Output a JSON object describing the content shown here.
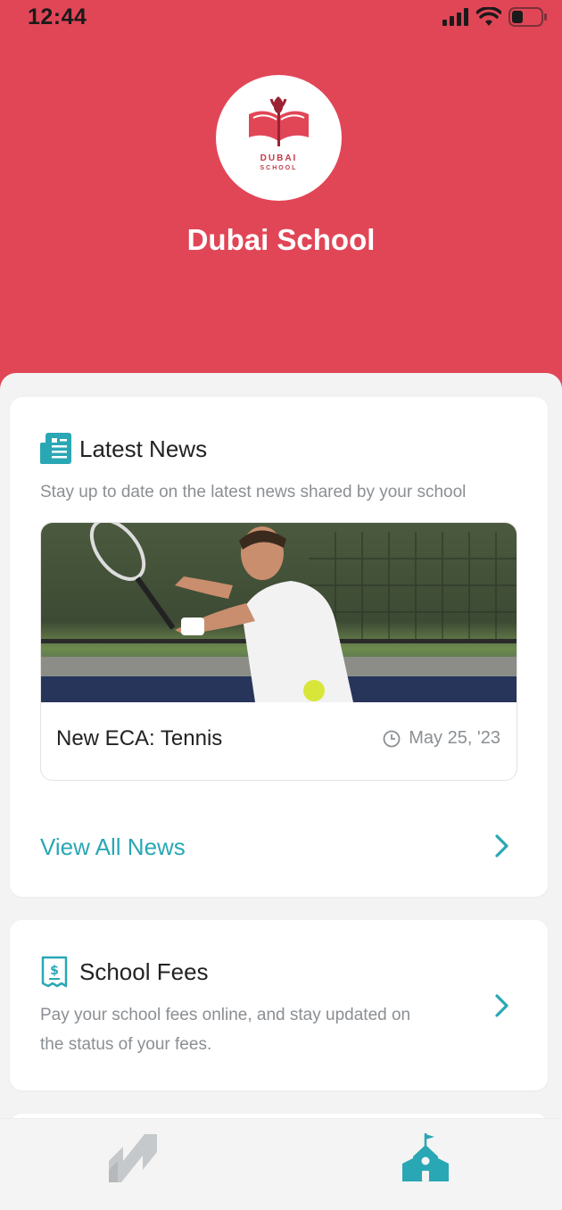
{
  "status_bar": {
    "time": "12:44"
  },
  "header": {
    "logo_line1": "DUBAI",
    "logo_line2": "SCHOOL",
    "school_name": "Dubai School"
  },
  "news_card": {
    "title": "Latest News",
    "description": "Stay up to date on the latest news shared by your school",
    "item": {
      "title": "New ECA: Tennis",
      "date": "May 25, '23"
    },
    "view_all_label": "View All News"
  },
  "fees_card": {
    "title": "School Fees",
    "description_line1": "Pay your school fees online, and stay updated on",
    "description_line2": "the status of your fees."
  },
  "colors": {
    "header_red": "#e14656",
    "accent_teal": "#2aa7b5",
    "muted_text": "#8b8f93",
    "nav_inactive": "#c5c9cb"
  },
  "icons": {
    "news": "newspaper-icon",
    "fees": "receipt-dollar-icon",
    "date": "clock-icon",
    "chevron": "chevron-right-icon",
    "nav_left": "brand-logo-icon",
    "nav_right": "school-icon"
  },
  "bottom_nav": {
    "active": "school"
  }
}
